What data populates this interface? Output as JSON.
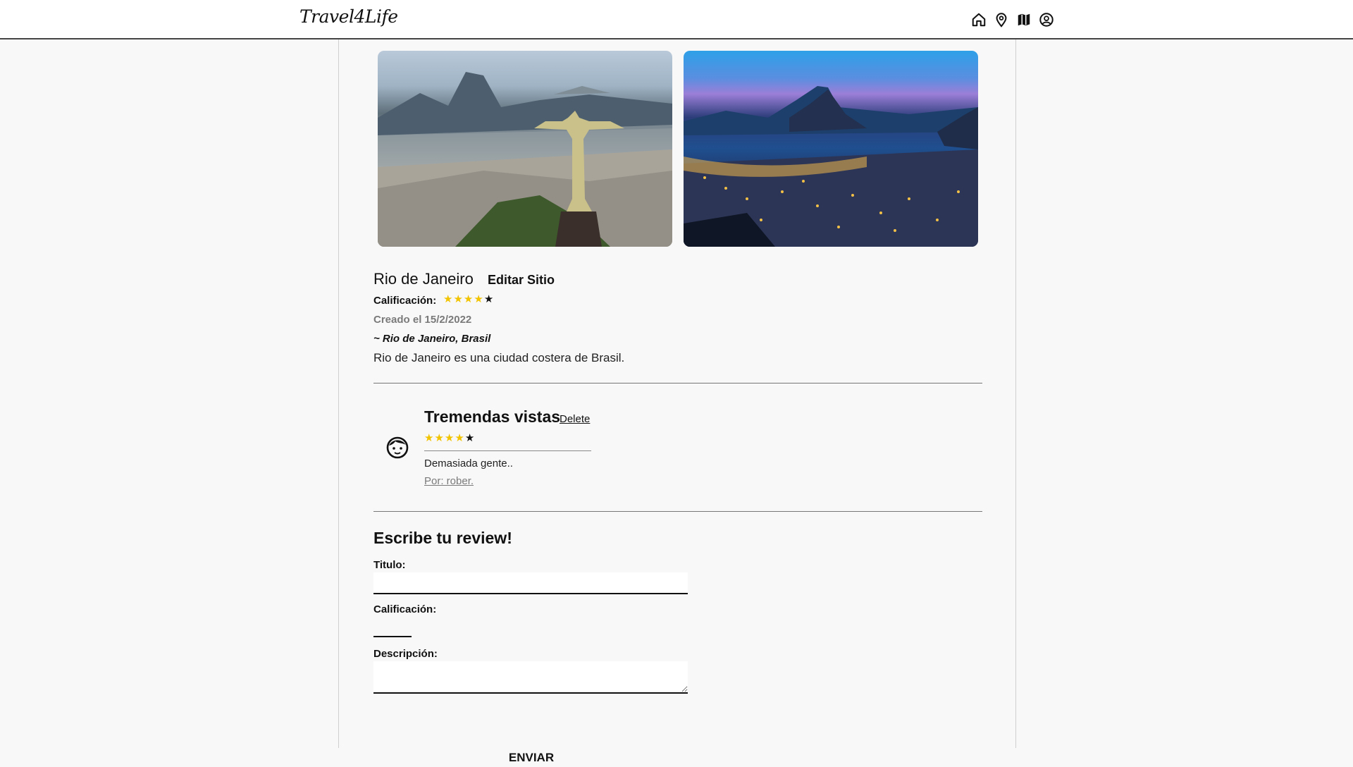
{
  "header": {
    "logo_text": "Travel4Life",
    "nav_icons": [
      "home-icon",
      "location-pin-icon",
      "map-icon",
      "user-circle-icon"
    ]
  },
  "site": {
    "photos": [
      {
        "name": "photo-christ-the-redeemer"
      },
      {
        "name": "photo-rio-night-bay"
      }
    ],
    "title": "Rio de Janeiro",
    "edit_label": "Editar Sitio",
    "rating_label": "Calificación:",
    "rating": 4,
    "rating_max": 5,
    "created": "Creado el 15/2/2022",
    "location": "~ Rio de Janeiro, Brasil",
    "description": "Rio de Janeiro es una ciudad costera de Brasil."
  },
  "review": {
    "title": "Tremendas vistas",
    "delete_label": "Delete",
    "rating": 4,
    "rating_max": 5,
    "text": "Demasiada gente..",
    "author": "Por: rober."
  },
  "form": {
    "heading": "Escribe tu review!",
    "title_label": "Titulo:",
    "title_value": "",
    "rating_label": "Calificación:",
    "rating_value": "",
    "description_label": "Descripción:",
    "description_value": "",
    "submit_label": "ENVIAR"
  },
  "colors": {
    "star_filled": "#f2c400",
    "star_empty": "#111111",
    "muted_text": "#7a7a7a",
    "background": "#f8f8f8"
  }
}
